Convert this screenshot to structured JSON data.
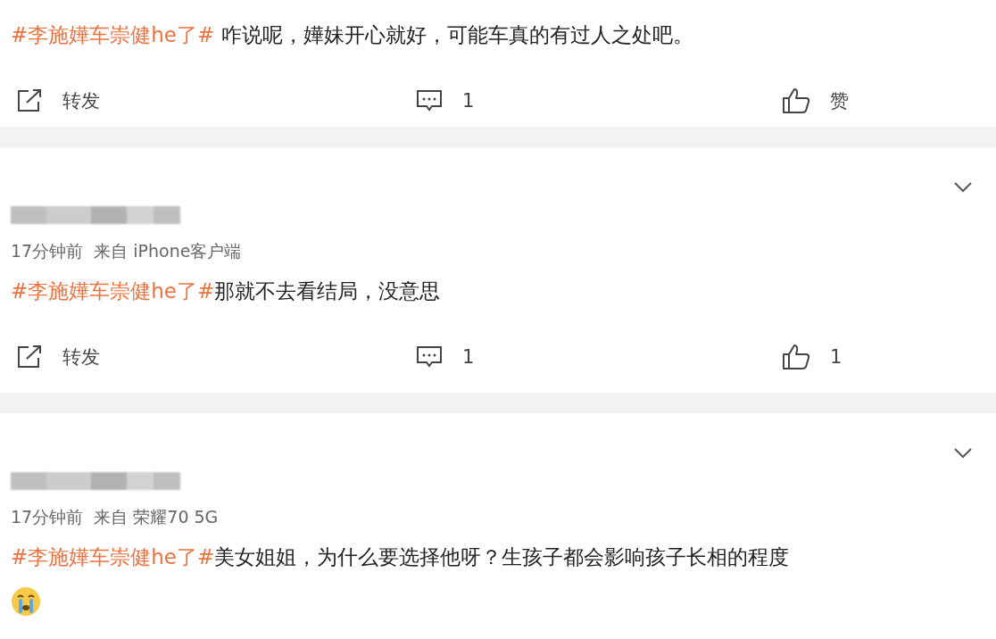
{
  "comments": [
    {
      "topic": "#李施嬅车崇健he了#",
      "text": " 咋说呢，嬅妹开心就好，可能车真的有过人之处吧。",
      "actions": {
        "share": "转发",
        "comments": "1",
        "likes": "赞"
      }
    },
    {
      "meta": "17分钟前  来自 iPhone客户端",
      "topic": "#李施嬅车崇健he了#",
      "text": "那就不去看结局，没意思",
      "actions": {
        "share": "转发",
        "comments": "1",
        "likes": "1"
      }
    },
    {
      "meta": "17分钟前  来自 荣耀70 5G",
      "topic": "#李施嬅车崇健he了#",
      "text": "美女姐姐，为什么要选择他呀？生孩子都会影响孩子长相的程度",
      "emoji": true
    }
  ]
}
